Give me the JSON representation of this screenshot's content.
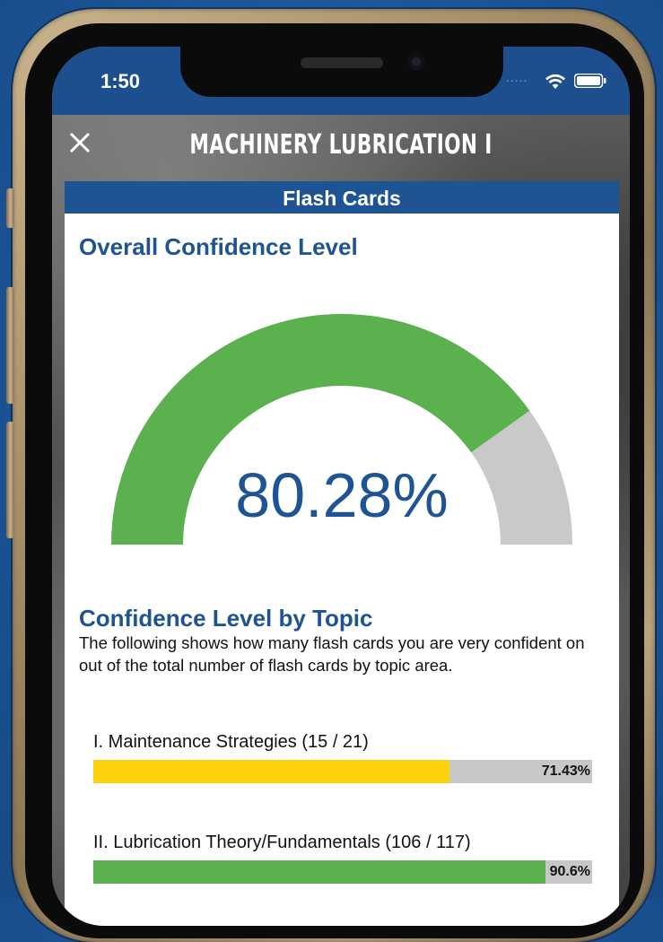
{
  "status_bar": {
    "time": "1:50",
    "signal_dots": "....."
  },
  "app": {
    "title": "MACHINERY LUBRICATION I"
  },
  "card": {
    "header": "Flash Cards",
    "overall_heading": "Overall Confidence Level",
    "gauge": {
      "value_text": "80.28%",
      "value": 80.28,
      "max": 100,
      "fill_color": "#5bb14e",
      "track_color": "#c9c9c9"
    },
    "topic_heading": "Confidence Level by Topic",
    "topic_description": "The following shows how many flash cards you are very confident on out of the total number of flash cards by topic area.",
    "topics": [
      {
        "label": "I. Maintenance Strategies (15 / 21)",
        "percent_text": "71.43%",
        "value": 71.43,
        "color": "#fdd10b"
      },
      {
        "label": "II. Lubrication Theory/Fundamentals (106 / 117)",
        "percent_text": "90.6%",
        "value": 90.6,
        "color": "#5bb14e"
      }
    ]
  },
  "colors": {
    "brand_blue": "#1e5394",
    "background_blue": "#1d5596"
  }
}
